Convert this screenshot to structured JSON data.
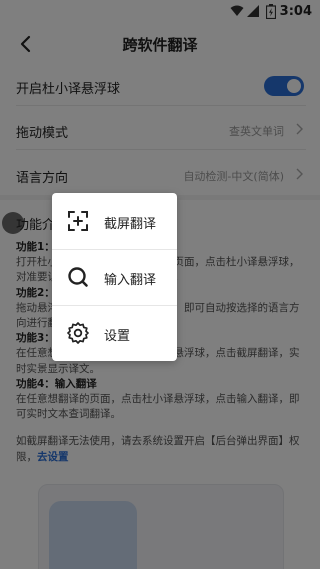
{
  "status_bar": {
    "time": "3:04"
  },
  "header": {
    "title": "跨软件翻译"
  },
  "settings": {
    "float_toggle": {
      "label": "开启杜小译悬浮球",
      "enabled": true
    },
    "drag_mode": {
      "label": "拖动模式",
      "value": "查英文单词"
    },
    "language": {
      "label": "语言方向",
      "value": "自动检测-中文(简体)"
    }
  },
  "intro": {
    "title": "功能介绍",
    "features": [
      {
        "title": "功能1：截屏翻译",
        "desc": "打开杜小译悬浮球，在任意翻译的页面，点击杜小译悬浮球，对准要识别的单词，即可完成翻译。"
      },
      {
        "title": "功能2：拖动悬浮球取词",
        "desc": "拖动悬浮球放在你想要翻译的页面，即可自动按选择的语言方向进行翻译。"
      },
      {
        "title": "功能3：截屏翻译",
        "desc": "在任意想翻译的页面，点击杜小译悬浮球，点击截屏翻译，实时实景显示译文。"
      },
      {
        "title": "功能4：输入翻译",
        "desc": "在任意想翻译的页面，点击杜小译悬浮球，点击输入翻译，即可实时文本查词翻译。"
      }
    ],
    "note_text": "如截屏翻译无法使用，请去系统设置开启【后台弹出界面】权限，",
    "note_link": "去设置"
  },
  "menu": {
    "items": [
      {
        "label": "截屏翻译",
        "icon": "screenshot-translate-icon"
      },
      {
        "label": "输入翻译",
        "icon": "search-icon"
      },
      {
        "label": "设置",
        "icon": "gear-icon"
      }
    ]
  },
  "colors": {
    "accent": "#2b6fd6",
    "overlay": "rgba(0,0,0,0.5)"
  }
}
